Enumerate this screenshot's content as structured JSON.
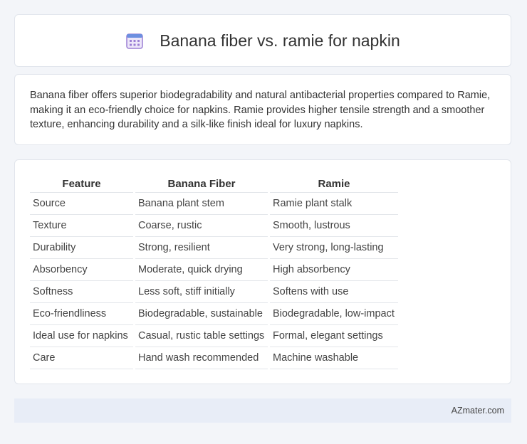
{
  "header": {
    "title": "Banana fiber vs. ramie for napkin",
    "icon": "calendar-icon"
  },
  "intro": {
    "text": "Banana fiber offers superior biodegradability and natural antibacterial properties compared to Ramie, making it an eco-friendly choice for napkins. Ramie provides higher tensile strength and a smoother texture, enhancing durability and a silk-like finish ideal for luxury napkins."
  },
  "table": {
    "headers": [
      "Feature",
      "Banana Fiber",
      "Ramie"
    ],
    "rows": [
      [
        "Source",
        "Banana plant stem",
        "Ramie plant stalk"
      ],
      [
        "Texture",
        "Coarse, rustic",
        "Smooth, lustrous"
      ],
      [
        "Durability",
        "Strong, resilient",
        "Very strong, long-lasting"
      ],
      [
        "Absorbency",
        "Moderate, quick drying",
        "High absorbency"
      ],
      [
        "Softness",
        "Less soft, stiff initially",
        "Softens with use"
      ],
      [
        "Eco-friendliness",
        "Biodegradable, sustainable",
        "Biodegradable, low-impact"
      ],
      [
        "Ideal use for napkins",
        "Casual, rustic table settings",
        "Formal, elegant settings"
      ],
      [
        "Care",
        "Hand wash recommended",
        "Machine washable"
      ]
    ]
  },
  "footer": {
    "brand": "AZmater.com"
  },
  "colors": {
    "background": "#f3f5f9",
    "card": "#ffffff",
    "footer": "#e8edf7",
    "icon_purple": "#9b7fd4",
    "icon_blue": "#6d8fe0"
  }
}
